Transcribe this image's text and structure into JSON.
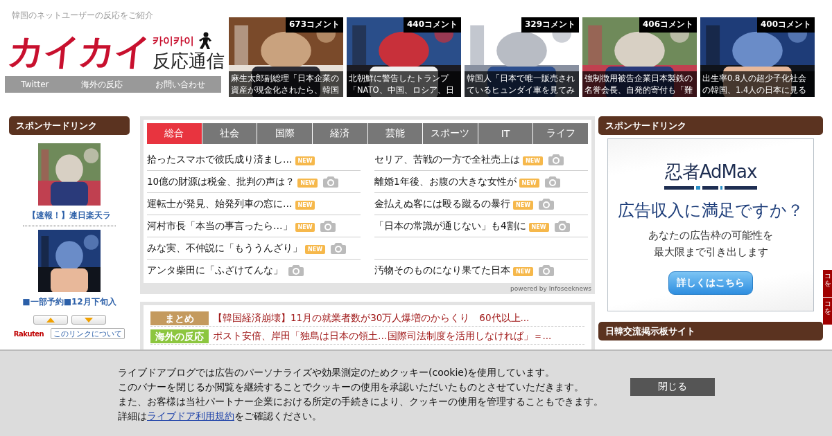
{
  "header": {
    "tagline": "韓国のネットユーザーの反応をご紹介",
    "logo": {
      "main": "カイカイ",
      "korean": "카이카이",
      "sub": "反応通信"
    },
    "nav": [
      "Twitter",
      "海外の反応",
      "お問い合わせ"
    ]
  },
  "featured": [
    {
      "comments": "673コメント",
      "caption": [
        "麻生太郎副総理「日本企業の",
        "資産が現金化されたら、韓国"
      ]
    },
    {
      "comments": "440コメント",
      "caption": [
        "北朝鮮に警告したトランプ",
        "「NATO、中国、ロシア、日"
      ]
    },
    {
      "comments": "329コメント",
      "caption": [
        "韓国人「日本で唯一販売され",
        "ているヒュンダイ車を見てみ"
      ]
    },
    {
      "comments": "406コメント",
      "caption": [
        "強制徴用被告企業日本製鉄の",
        "名誉会長、自発的寄付も「難"
      ]
    },
    {
      "comments": "400コメント",
      "caption": [
        "出生率0.8人の超少子化社会",
        "の韓国、1.4人の日本に見る"
      ]
    }
  ],
  "left_sidebar": {
    "title": "スポンサードリンク",
    "ads": [
      {
        "caption": "【速報！】連日楽天ラ"
      },
      {
        "caption": "■一部予約■12月下旬入"
      }
    ],
    "brand": "Rakuten",
    "about_button": "このリンクについて"
  },
  "news": {
    "tabs": [
      {
        "label": "総合",
        "selected": true
      },
      {
        "label": "社会",
        "selected": false
      },
      {
        "label": "国際",
        "selected": false
      },
      {
        "label": "経済",
        "selected": false
      },
      {
        "label": "芸能",
        "selected": false
      },
      {
        "label": "スポーツ",
        "selected": false
      },
      {
        "label": "IT",
        "selected": false
      },
      {
        "label": "ライフ",
        "selected": false
      }
    ],
    "rows": [
      {
        "left": {
          "title": "拾ったスマホで彼氏成り済まし…",
          "badge": "NEW",
          "photo": false
        },
        "right": {
          "title": "セリア、苦戦の一方で全社売上は",
          "badge": "NEW",
          "photo": true
        }
      },
      {
        "left": {
          "title": "10億の財源は税金、批判の声は？",
          "badge": "NEW",
          "photo": true
        },
        "right": {
          "title": "離婚1年後、お腹の大きな女性が",
          "badge": "NEW",
          "photo": true
        }
      },
      {
        "left": {
          "title": "運転士が発見、始発列車の窓に…",
          "badge": "NEW",
          "photo": false
        },
        "right": {
          "title": "金払えぬ客には殴る蹴るの暴行",
          "badge": "NEW",
          "photo": true
        }
      },
      {
        "left": {
          "title": "河村市長「本当の事言ったら…」",
          "badge": "NEW",
          "photo": true
        },
        "right": {
          "title": "「日本の常識が通じない」も4割に",
          "badge": "NEW",
          "photo": true
        }
      },
      {
        "left": {
          "title": "みな実、不仲説に「もううんざり」",
          "badge": "NEW",
          "photo": true
        }
      },
      {
        "left": {
          "title": "アンタ柴田に「ふざけてんな」",
          "photo": true
        },
        "right": {
          "title": "汚物そのものになり果てた日本",
          "badge": "NEW",
          "photo": true
        }
      }
    ],
    "credit": "powered by Infoseeknews"
  },
  "headlines": [
    {
      "tag": "まとめ",
      "color": "#c49a5e",
      "title": "【韓国経済崩壊】11月の就業者数が30万人爆増のからくり　60代以上..."
    },
    {
      "tag": "海外の反応",
      "color": "#8cc63f",
      "title": "ポスト安倍、岸田「独島は日本の領土…国際司法制度を活用しなければ」＝..."
    }
  ],
  "right_sidebar": {
    "title": "スポンサードリンク",
    "ad": {
      "brand": "忍者AdMax",
      "headline": "広告収入に満足ですか？",
      "body": [
        "あなたの広告枠の可能性を",
        "最大限まで引き出します"
      ],
      "button": "詳しくはこちら"
    },
    "section_title": "日韓交流掲示板サイト"
  },
  "side_tabs": [
    "コを",
    "コを"
  ],
  "cookie_banner": {
    "lines": [
      "ライブドアブログでは広告のパーソナライズや効果測定のためクッキー(cookie)を使用しています。",
      "このバナーを閉じるか閲覧を継続することでクッキーの使用を承認いただいたものとさせていただきます。",
      "また、お客様は当社パートナー企業における所定の手続きにより、クッキーの使用を管理することもできます。"
    ],
    "detail_prefix": "詳細は",
    "link": "ライブドア利用規約",
    "detail_suffix": "をご確認ください。",
    "close_button": "閉じる"
  }
}
